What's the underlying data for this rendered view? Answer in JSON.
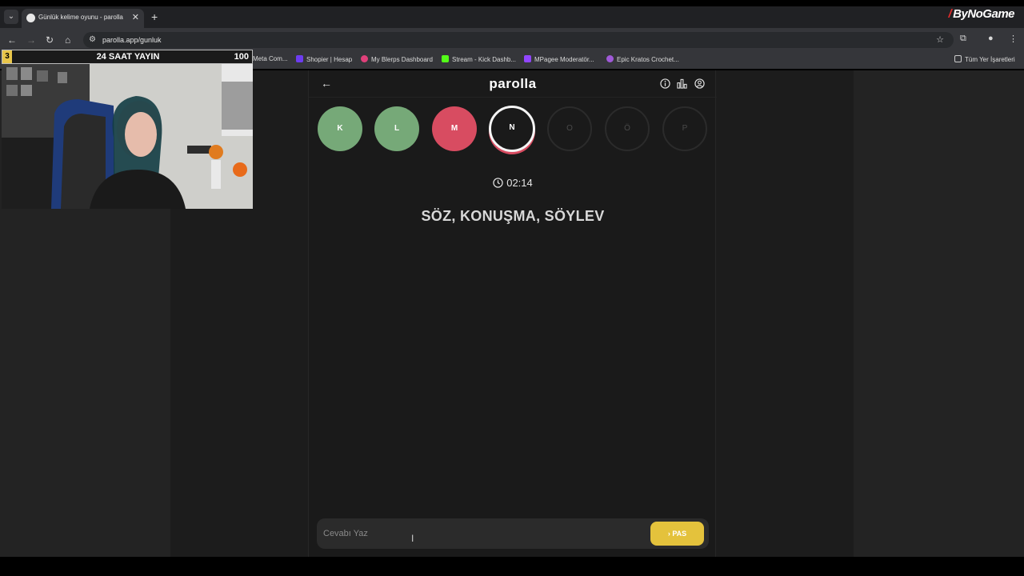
{
  "browser": {
    "tab_title": "Günlük kelime oyunu - parolla",
    "url": "parolla.app/gunluk",
    "brand_overlay": "ByNoGame",
    "bookmarks": [
      {
        "label": "Meta Com...",
        "color": "#4a6cf7"
      },
      {
        "label": "Shopier | Hesap",
        "color": "#6d3cf0"
      },
      {
        "label": "My Blerps Dashboard",
        "color": "#e0407a"
      },
      {
        "label": "Stream - Kick Dashb...",
        "color": "#53fc18"
      },
      {
        "label": "MPagee Moderatör...",
        "color": "#9146ff"
      },
      {
        "label": "Epic Kratos Crochet...",
        "color": "#a05ad8"
      }
    ],
    "all_bookmarks": "Tüm Yer İşaretleri"
  },
  "app": {
    "logo": "parolla",
    "letters": [
      {
        "char": "K",
        "state": "correct"
      },
      {
        "char": "L",
        "state": "correct"
      },
      {
        "char": "M",
        "state": "wrong"
      },
      {
        "char": "N",
        "state": "active"
      },
      {
        "char": "O",
        "state": "pending"
      },
      {
        "char": "Ö",
        "state": "pending"
      },
      {
        "char": "P",
        "state": "pending"
      }
    ],
    "timer": "02:14",
    "clue": "SÖZ, KONUŞMA, SÖYLEV",
    "input_placeholder": "Cevabı Yaz",
    "pass_label": "PAS",
    "colors": {
      "correct": "#76a978",
      "wrong": "#d84c61",
      "pass": "#e4c23c"
    }
  },
  "overlay": {
    "left_value": "3",
    "title": "24 SAAT YAYIN",
    "right_value": "100"
  }
}
